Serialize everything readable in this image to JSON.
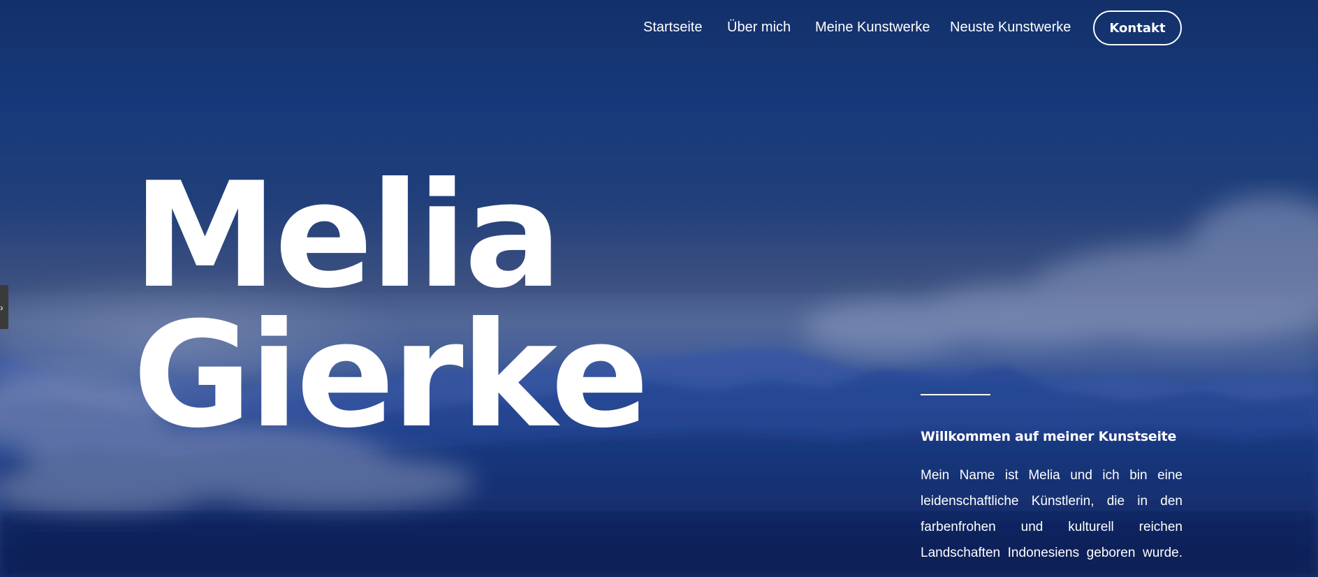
{
  "nav": {
    "items": [
      {
        "label": "Startseite"
      },
      {
        "label": "Über mich"
      },
      {
        "label": "Meine Kunstwerke"
      },
      {
        "label": "Neuste Kunstwerke"
      }
    ],
    "contact_label": "Kontakt"
  },
  "hero": {
    "title_line1": "Melia",
    "title_line2": "Gierke"
  },
  "intro": {
    "heading": "Willkommen auf meiner Kunstseite",
    "text": "Mein Name ist Melia und ich bin eine leidenschaftliche Künstlerin, die in den farbenfrohen und kulturell reichen Landschaften Indonesiens geboren wurde."
  },
  "side_tab": {
    "icon": "chevron-right-icon",
    "glyph": "›"
  },
  "colors": {
    "background_top": "#13306a",
    "background_bottom": "#0d2a66",
    "text": "#ffffff"
  }
}
